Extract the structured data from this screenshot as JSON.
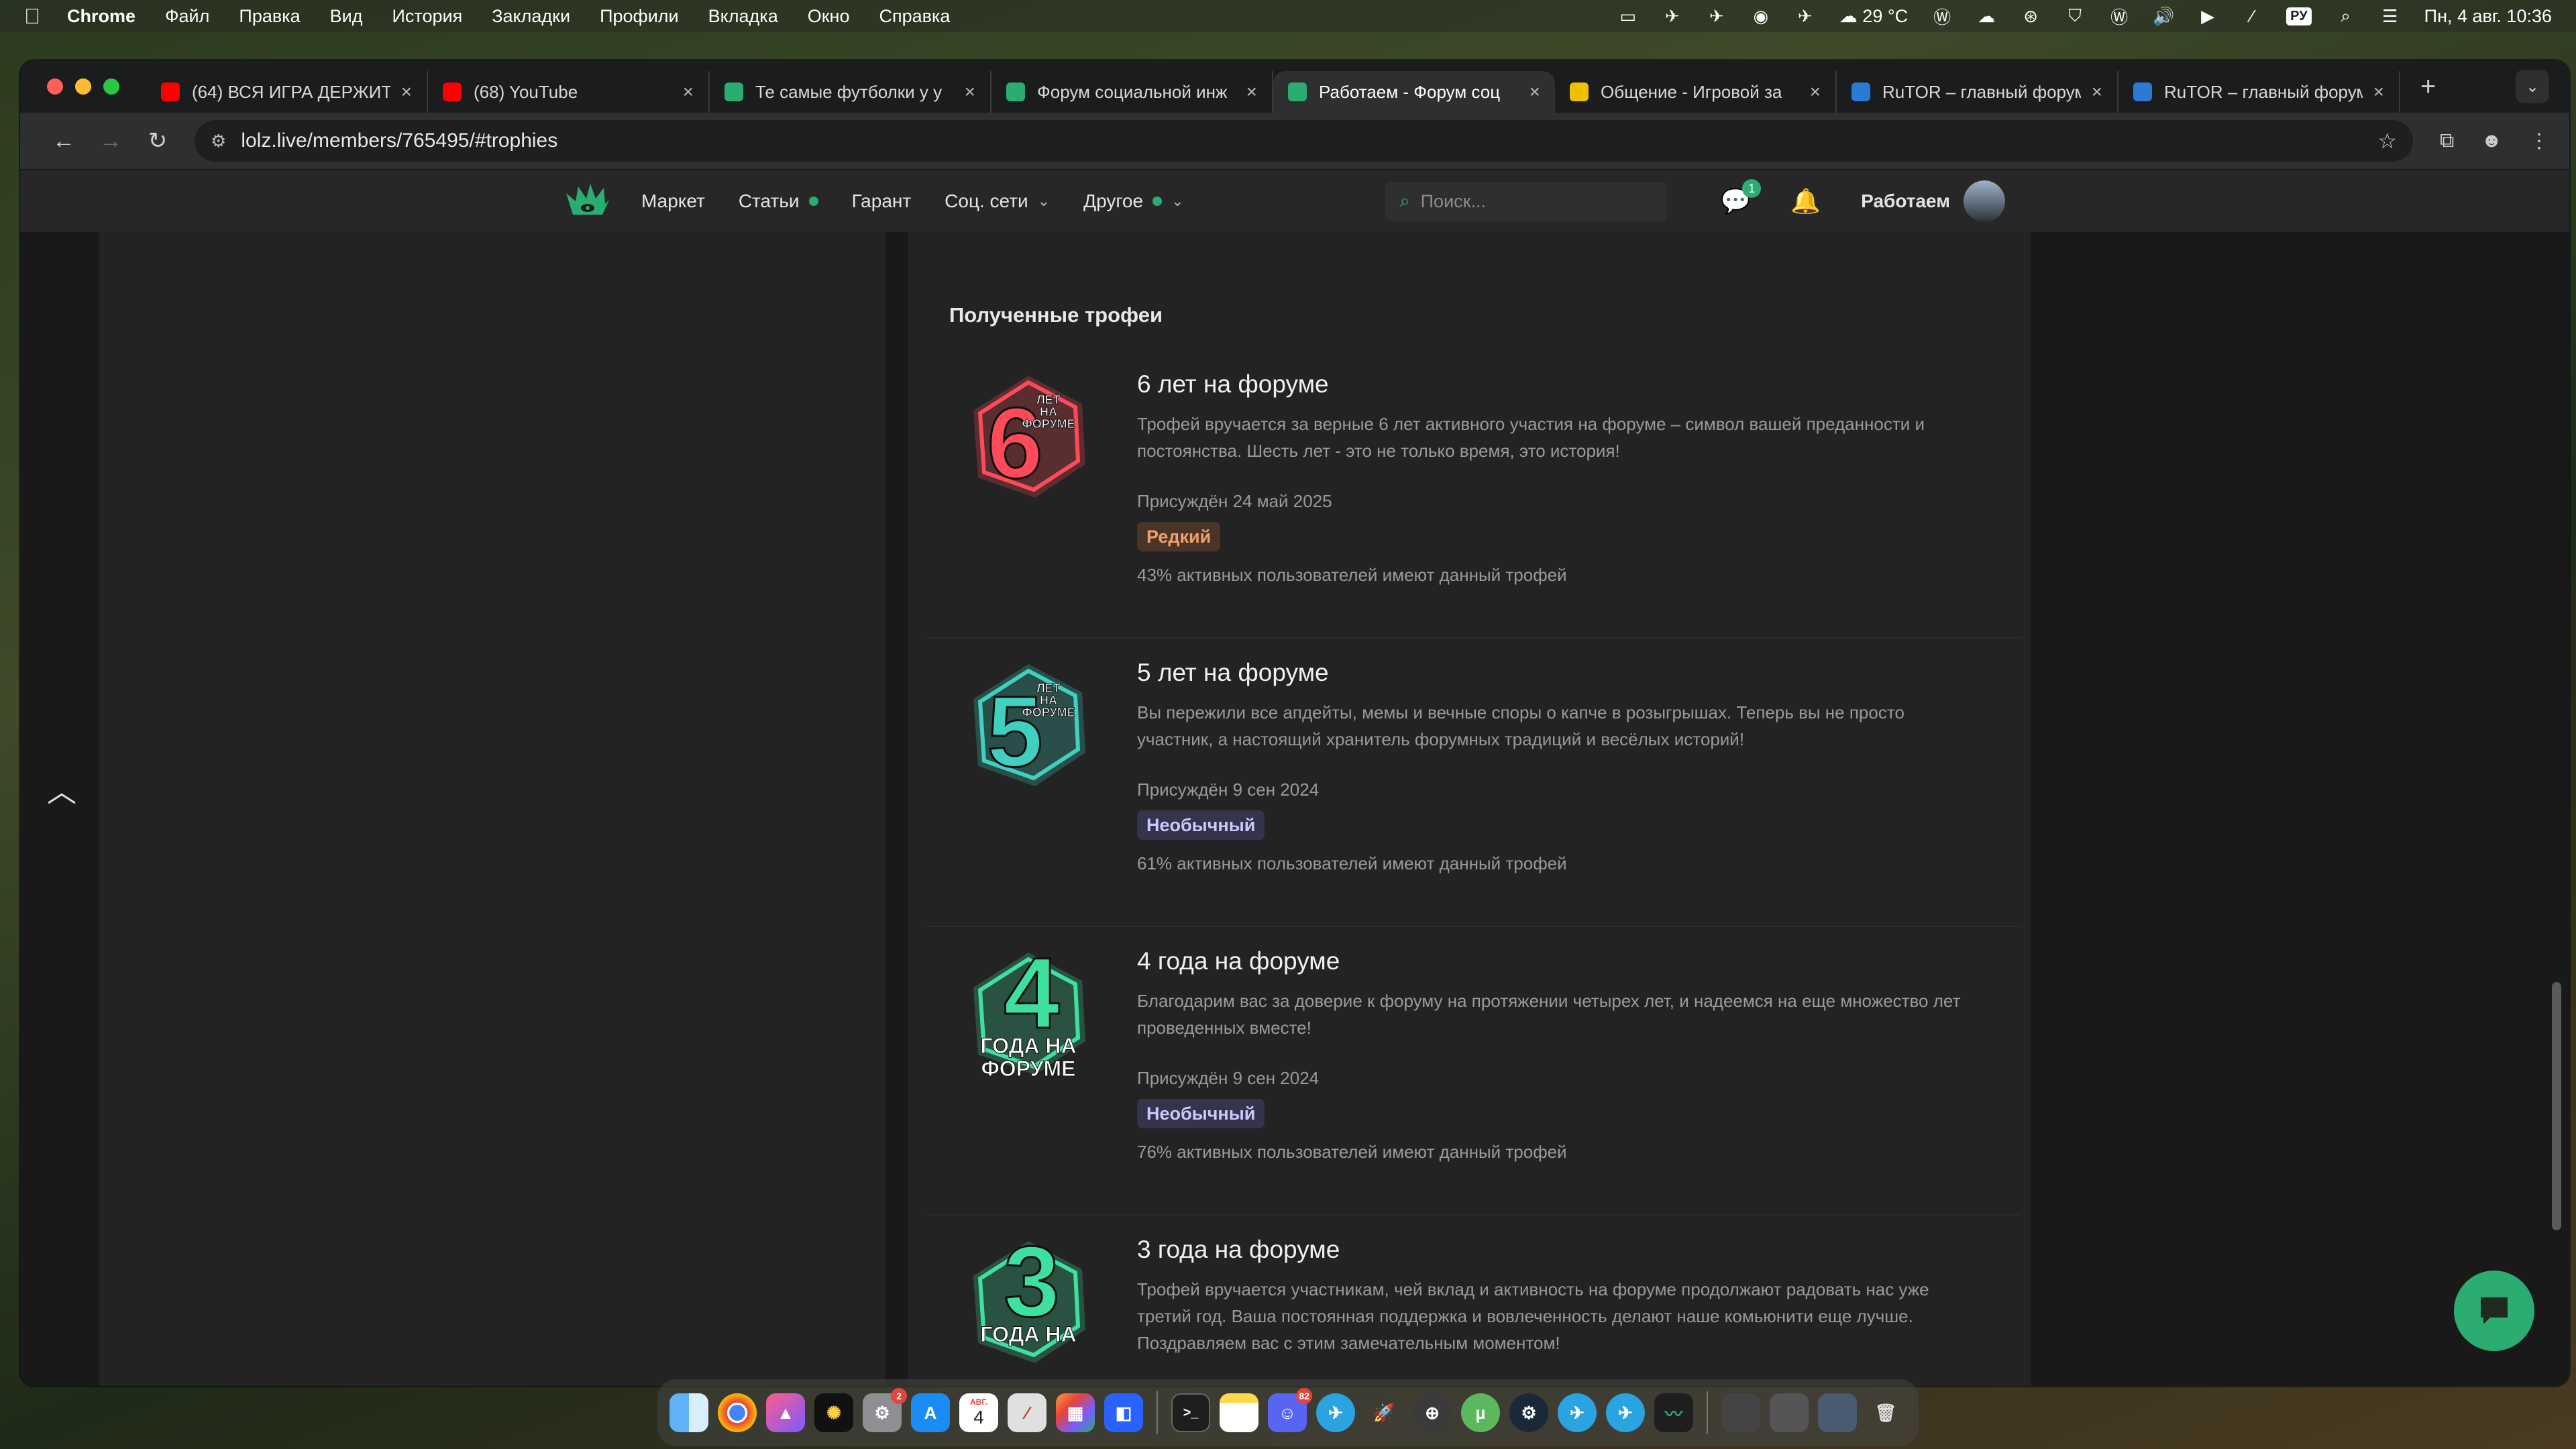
{
  "menubar": {
    "app": "Chrome",
    "items": [
      "Файл",
      "Правка",
      "Вид",
      "История",
      "Закладки",
      "Профили",
      "Вкладка",
      "Окно",
      "Справка"
    ],
    "weather": "29 °C",
    "input_lang": "РУ",
    "clock": "Пн, 4 авг. 10:36"
  },
  "tabs": [
    {
      "label": "(64) ВСЯ ИГРА ДЕРЖИТ",
      "icon": "youtube-icon",
      "color": "#ff0000"
    },
    {
      "label": "(68) YouTube",
      "icon": "youtube-icon",
      "color": "#ff0000"
    },
    {
      "label": "Те самые футболки у у",
      "icon": "lolz-icon",
      "color": "#2bad72"
    },
    {
      "label": "Форум социальной инж",
      "icon": "lolz-icon",
      "color": "#2bad72"
    },
    {
      "label": "Работаем - Форум соц",
      "icon": "lolz-icon",
      "color": "#2bad72",
      "active": true
    },
    {
      "label": "Общение - Игровой за",
      "icon": "d-icon",
      "color": "#f0c000"
    },
    {
      "label": "RuTOR – главный форум",
      "icon": "rutor-icon",
      "color": "#2a7ad6"
    },
    {
      "label": "RuTOR – главный форум",
      "icon": "rutor-icon",
      "color": "#2a7ad6"
    }
  ],
  "toolbar": {
    "url": "lolz.live/members/765495/#trophies"
  },
  "sitenav": {
    "items": [
      {
        "label": "Маркет",
        "dot": false,
        "chevron": false
      },
      {
        "label": "Статьи",
        "dot": true,
        "chevron": false
      },
      {
        "label": "Гарант",
        "dot": false,
        "chevron": false
      },
      {
        "label": "Соц. сети",
        "dot": false,
        "chevron": true
      },
      {
        "label": "Другое",
        "dot": true,
        "chevron": true
      }
    ],
    "search_placeholder": "Поиск...",
    "messages_badge": "1",
    "username": "Работаем"
  },
  "trophies_section": {
    "title": "Полученные трофеи",
    "items": [
      {
        "name": "6 лет на форуме",
        "description": "Трофей вручается за верные 6 лет активного участия на форуме – символ вашей преданности и постоянства. Шесть лет - это не только время, это история!",
        "awarded": "Присуждён 24 май 2025",
        "rarity": "Редкий",
        "rarity_color": "#f0a06a",
        "rarity_bg": "#4a3427",
        "percent_text": "43% активных пользователей имеют данный трофей",
        "badge_number": "6",
        "badge_text": [
          "ЛЕТ",
          "НА",
          "ФОРУМЕ"
        ],
        "badge_color": "#ff4a5a"
      },
      {
        "name": "5 лет на форуме",
        "description": "Вы пережили все апдейты, мемы и вечные споры о капче в розыгрышах. Теперь вы не просто участник, а настоящий хранитель форумных традиций и весёлых историй!",
        "awarded": "Присуждён 9 сен 2024",
        "rarity": "Необычный",
        "rarity_color": "#c9c9ff",
        "rarity_bg": "#34344a",
        "percent_text": "61% активных пользователей имеют данный трофей",
        "badge_number": "5",
        "badge_text": [
          "ЛЕТ",
          "НА",
          "ФОРУМЕ"
        ],
        "badge_color": "#3fd0c0"
      },
      {
        "name": "4 года на форуме",
        "description": "Благодарим вас за доверие к форуму на протяжении четырех лет, и надеемся на еще множество лет проведенных вместе!",
        "awarded": "Присуждён 9 сен 2024",
        "rarity": "Необычный",
        "rarity_color": "#c9c9ff",
        "rarity_bg": "#34344a",
        "percent_text": "76% активных пользователей имеют данный трофей",
        "badge_number": "4",
        "badge_text": [
          "ГОДА НА",
          "ФОРУМЕ"
        ],
        "badge_color": "#3ee0a0"
      },
      {
        "name": "3 года на форуме",
        "description": "Трофей вручается участникам, чей вклад и активность на форуме продолжают радовать нас уже третий год. Ваша постоянная поддержка и вовлеченность делают наше комьюнити еще лучше. Поздравляем вас с этим замечательным моментом!",
        "awarded": "",
        "rarity": "",
        "rarity_color": "",
        "rarity_bg": "",
        "percent_text": "",
        "badge_number": "3",
        "badge_text": [
          "ГОДА НА"
        ],
        "badge_color": "#3ee0a0"
      }
    ]
  },
  "dock": {
    "calendar_month": "АВГ.",
    "calendar_day": "4",
    "settings_badge": "2",
    "discord_badge": "82"
  }
}
